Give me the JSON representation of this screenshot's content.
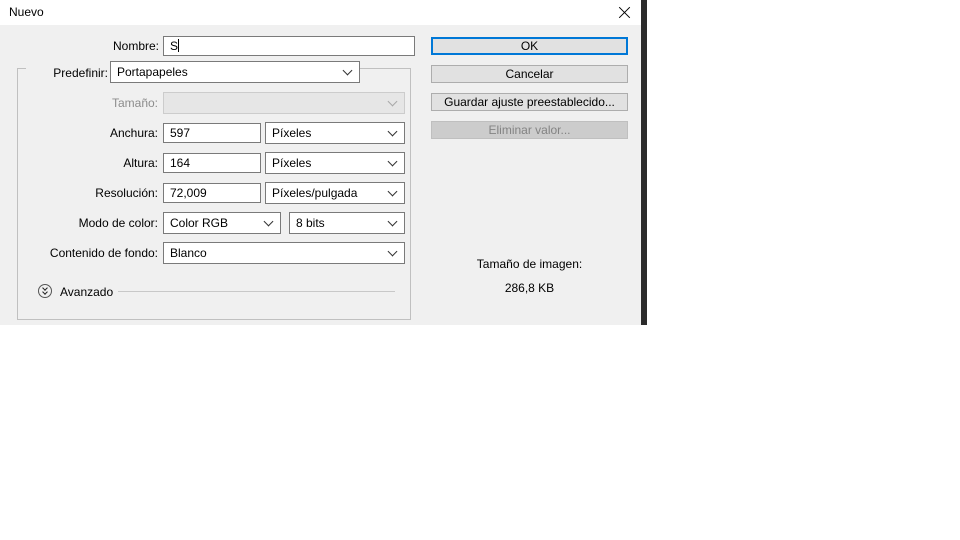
{
  "dialog": {
    "title": "Nuevo",
    "close_icon": "close-icon"
  },
  "fields": {
    "name": {
      "label": "Nombre:",
      "value": "S"
    },
    "preset": {
      "label": "Predefinir:",
      "value": "Portapapeles"
    },
    "size": {
      "label": "Tamaño:",
      "value": ""
    },
    "width": {
      "label": "Anchura:",
      "value": "597",
      "unit": "Píxeles"
    },
    "height": {
      "label": "Altura:",
      "value": "164",
      "unit": "Píxeles"
    },
    "resolution": {
      "label": "Resolución:",
      "value": "72,009",
      "unit": "Píxeles/pulgada"
    },
    "color_mode": {
      "label": "Modo de color:",
      "mode": "Color RGB",
      "depth": "8 bits"
    },
    "background": {
      "label": "Contenido de fondo:",
      "value": "Blanco"
    }
  },
  "advanced": {
    "label": "Avanzado",
    "icon": "expand-double-chevron-icon"
  },
  "buttons": {
    "ok": "OK",
    "cancel": "Cancelar",
    "save_preset": "Guardar ajuste preestablecido...",
    "delete_preset": "Eliminar valor..."
  },
  "image_size": {
    "label": "Tamaño de imagen:",
    "value": "286,8 KB"
  },
  "colors": {
    "accent": "#0078d7",
    "dialog_bg": "#f0f0f0"
  }
}
